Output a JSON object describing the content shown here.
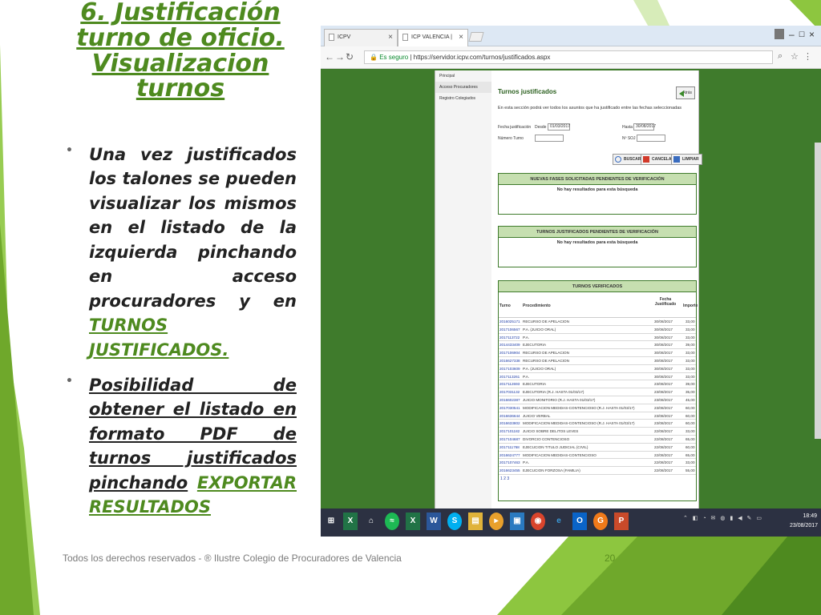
{
  "slide": {
    "title": "6. Justificación turno de oficio. Visualizacion turnos",
    "bullet1_text": "Una vez justificados los talones se pueden visualizar los mismos en el listado de la izquierda pinchando en acceso procuradores y en",
    "bullet1_link": "TURNOS JUSTIFICADOS.",
    "bullet2_text": "Posibilidad de obtener el listado en formato PDF de turnos justificados pinchando",
    "bullet2_link": "EXPORTAR RESULTADOS",
    "footer": "Todos los derechos reservados - ® Ilustre Colegio de Procuradores de Valencia",
    "page_number": "20",
    "accent_color": "#4e8a1f"
  },
  "browser": {
    "tab1": "ICPV",
    "tab2": "ICP VALENCIA | Turnos ju",
    "url_secure": "Es seguro",
    "url": "https://servidor.icpv.com/turnos/justificados.aspx",
    "menu": [
      "Principal",
      "Acceso Procuradores",
      "Registro Colegiados"
    ]
  },
  "page": {
    "title": "Turnos justificados",
    "back": "Atrás",
    "desc": "En esta sección podrá ver todos los asuntos que ha justificado entre las fechas seleccionadas",
    "fecha_label": "Fecha justificación",
    "desde_label": "Desde",
    "desde_value": "01/03/2017",
    "hasta_label": "Hasta",
    "hasta_value": "30/08/2017",
    "numero_label": "Número Turno",
    "nsoj_label": "Nº SOJ",
    "buscar": "BUSCAR",
    "cancelar": "CANCELAR",
    "limpiar": "LIMPIAR",
    "section1_head": "NUEVAS FASES SOLICITADAS PENDIENTES DE VERIFICACIÓN",
    "section1_msg": "No hay resultados para esta búsqueda",
    "section2_head": "TURNOS JUSTIFICADOS PENDIENTES DE VERIFICACIÓN",
    "section2_msg": "No hay resultados para esta búsqueda",
    "section3_head": "TURNOS VERIFICADOS",
    "col_turno": "Turno",
    "col_proc": "Procedimiento",
    "col_fecha": "Fecha Justificado",
    "col_importe": "Importe",
    "pager": "1 2 3",
    "export": "EXPORTAR RESULTADOS",
    "rows": [
      [
        "2016025171",
        "RECURSO DE APELACION",
        "30/08/2017",
        "33,00"
      ],
      [
        "2017106567",
        "P.A. (JUICIO ORAL)",
        "30/08/2017",
        "33,00"
      ],
      [
        "2017113722",
        "P.A.",
        "30/08/2017",
        "33,00"
      ],
      [
        "2014433409",
        "EJECUTORIA",
        "30/08/2017",
        "39,00"
      ],
      [
        "2017106904",
        "RECURSO DE APELACION",
        "30/08/2017",
        "33,00"
      ],
      [
        "2016627338",
        "RECURSO DE APELACION",
        "30/08/2017",
        "33,00"
      ],
      [
        "2017103609",
        "P.A. (JUICIO ORAL)",
        "30/08/2017",
        "33,00"
      ],
      [
        "2017113261",
        "P.A.",
        "30/08/2017",
        "33,00"
      ],
      [
        "2017112693",
        "EJECUTORIA",
        "23/08/2017",
        "39,00"
      ],
      [
        "2017031132",
        "EJECUTORIA (R.J. HASTA 01/03/17)",
        "23/08/2017",
        "35,00"
      ],
      [
        "2016602387",
        "JUICIO MONITORIO (R.J. HASTA 01/03/17)",
        "23/08/2017",
        "45,00"
      ],
      [
        "2017030541",
        "MODIFICACION MEDIDAS-CONTENCIOSO (R.J. HASTA 01/03/17)",
        "23/08/2017",
        "60,00"
      ],
      [
        "2016636644",
        "JUICIO VERBAL",
        "23/08/2017",
        "60,00"
      ],
      [
        "2016633802",
        "MODIFICACION MEDIDAS-CONTENCIOSO (R.J. HASTA 01/03/17)",
        "23/08/2017",
        "60,00"
      ],
      [
        "2017101182",
        "JUICIO SOBRE DELITOS LEVES",
        "22/08/2017",
        "33,00"
      ],
      [
        "2017104687",
        "DIVORCIO CONTENCIOSO",
        "22/08/2017",
        "65,00"
      ],
      [
        "2017111768",
        "EJECUCION TITULO JUDICIAL (CIVIL)",
        "22/08/2017",
        "60,00"
      ],
      [
        "2016624777",
        "MODIFICACION MEDIDAS-CONTENCIOSO",
        "22/08/2017",
        "65,00"
      ],
      [
        "2017107463",
        "P.A.",
        "22/08/2017",
        "33,00"
      ],
      [
        "2016623455",
        "EJECUCION FORZOSA (FAMILIA)",
        "22/08/2017",
        "55,00"
      ]
    ]
  },
  "taskbar": {
    "time": "18:49",
    "date": "23/08/2017"
  }
}
